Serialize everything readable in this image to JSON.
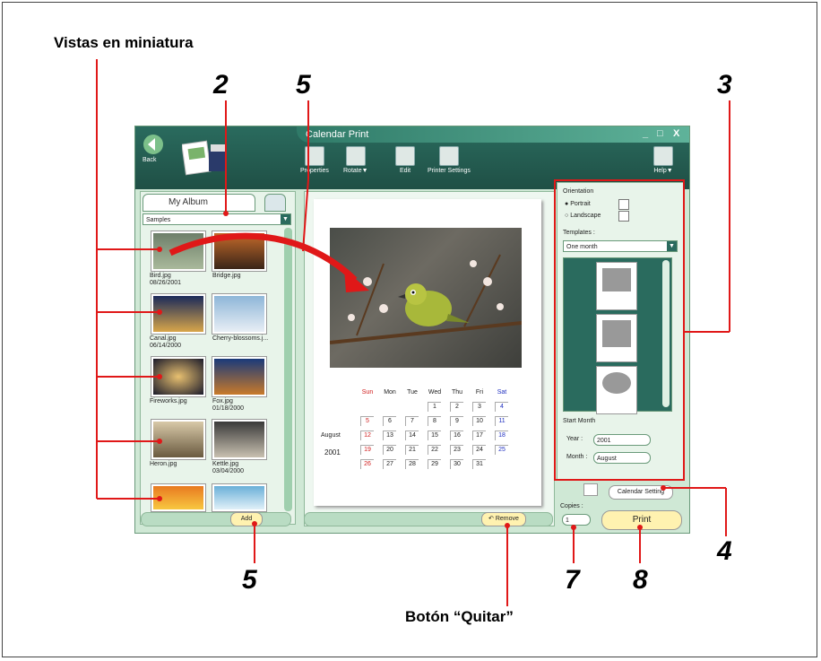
{
  "callouts": {
    "vistas": "Vistas en miniatura",
    "n2": "2",
    "n5_top": "5",
    "n3": "3",
    "n4": "4",
    "n5_bottom": "5",
    "n7": "7",
    "n8": "8",
    "quitar": "Botón “Quitar”"
  },
  "app": {
    "title": "Calendar Print",
    "back_label": "Back",
    "window_controls": [
      "_",
      "□",
      "X"
    ],
    "toolbar": [
      "Properties",
      "Rotate▼",
      "Edit",
      "Printer Settings"
    ],
    "help_label": "Help▼"
  },
  "left_panel": {
    "tab_label": "My Album",
    "album_select": "Samples",
    "thumbnails": [
      {
        "name": "Bird.jpg",
        "date": "08/26/2001"
      },
      {
        "name": "Bridge.jpg",
        "date": ""
      },
      {
        "name": "Canal.jpg",
        "date": "06/14/2000"
      },
      {
        "name": "Cherry-blossoms.j...",
        "date": ""
      },
      {
        "name": "Fireworks.jpg",
        "date": ""
      },
      {
        "name": "Fox.jpg",
        "date": "01/18/2000"
      },
      {
        "name": "Heron.jpg",
        "date": ""
      },
      {
        "name": "Kettle.jpg",
        "date": "03/04/2000"
      },
      {
        "name": "",
        "date": ""
      },
      {
        "name": "",
        "date": ""
      }
    ],
    "add_label": "Add"
  },
  "calendar": {
    "month": "August",
    "year": "2001",
    "days": [
      "Sun",
      "Mon",
      "Tue",
      "Wed",
      "Thu",
      "Fri",
      "Sat"
    ],
    "weeks": [
      [
        "",
        "",
        "",
        "1",
        "2",
        "3",
        "4"
      ],
      [
        "5",
        "6",
        "7",
        "8",
        "9",
        "10",
        "11"
      ],
      [
        "12",
        "13",
        "14",
        "15",
        "16",
        "17",
        "18"
      ],
      [
        "19",
        "20",
        "21",
        "22",
        "23",
        "24",
        "25"
      ],
      [
        "26",
        "27",
        "28",
        "29",
        "30",
        "31",
        ""
      ]
    ],
    "remove_label": "Remove"
  },
  "right_panel": {
    "orientation_label": "Orientation",
    "portrait": "Portrait",
    "landscape": "Landscape",
    "templates_label": "Templates :",
    "template_select": "One month",
    "start_month_label": "Start Month",
    "year_label": "Year :",
    "year_value": "2001",
    "month_label": "Month :",
    "month_value": "August",
    "calendar_settings_label": "Calendar Setting",
    "copies_label": "Copies :",
    "copies_value": "1",
    "print_label": "Print"
  },
  "colors": {
    "accent": "#e01818",
    "window_bar": "#2a6b5e",
    "sunday": "#d02020",
    "saturday": "#2030c0"
  }
}
